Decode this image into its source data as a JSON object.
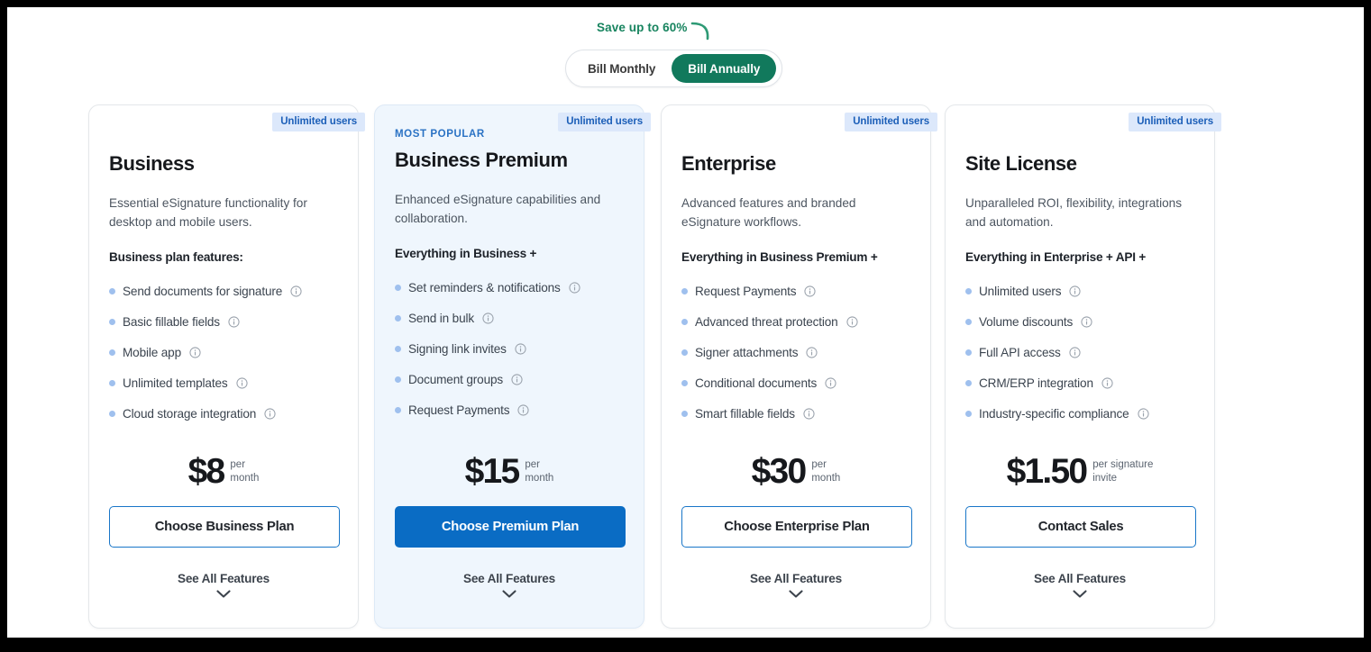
{
  "billing": {
    "save_note": "Save up to 60%",
    "options": [
      {
        "label": "Bill Monthly",
        "active": false
      },
      {
        "label": "Bill Annually",
        "active": true
      }
    ]
  },
  "colors": {
    "accent_blue": "#0a6cc4",
    "outline_blue": "#1976c8",
    "badge_bg": "#dce8fb",
    "badge_text": "#1c5fb8",
    "toggle_green": "#11795c",
    "save_green": "#18845f",
    "highlight_card_bg": "#eff6fd",
    "bullet_blue": "#9fc0ee"
  },
  "plans": [
    {
      "badge": "Unlimited users",
      "tag": "",
      "name": "Business",
      "description": "Essential eSignature functionality for desktop and mobile users.",
      "features_head": "Business plan features:",
      "features": [
        "Send documents for signature",
        "Basic fillable fields",
        "Mobile app",
        "Unlimited templates",
        "Cloud storage integration"
      ],
      "price": "$8",
      "price_unit_line1": "per",
      "price_unit_line2": "month",
      "cta": "Choose Business Plan",
      "cta_style": "outline",
      "see_all": "See All Features",
      "highlight": false
    },
    {
      "badge": "Unlimited users",
      "tag": "MOST POPULAR",
      "name": "Business Premium",
      "description": "Enhanced eSignature capabilities and collaboration.",
      "features_head": "Everything in Business +",
      "features": [
        "Set reminders & notifications",
        "Send in bulk",
        "Signing link invites",
        "Document groups",
        "Request Payments"
      ],
      "price": "$15",
      "price_unit_line1": "per",
      "price_unit_line2": "month",
      "cta": "Choose Premium Plan",
      "cta_style": "solid",
      "see_all": "See All Features",
      "highlight": true
    },
    {
      "badge": "Unlimited users",
      "tag": "",
      "name": "Enterprise",
      "description": "Advanced features and branded eSignature workflows.",
      "features_head": "Everything in Business Premium +",
      "features": [
        "Request Payments",
        "Advanced threat protection",
        "Signer attachments",
        "Conditional documents",
        "Smart fillable fields"
      ],
      "price": "$30",
      "price_unit_line1": "per",
      "price_unit_line2": "month",
      "cta": "Choose Enterprise Plan",
      "cta_style": "outline",
      "see_all": "See All Features",
      "highlight": false
    },
    {
      "badge": "Unlimited users",
      "tag": "",
      "name": "Site License",
      "description": "Unparalleled ROI, flexibility, integrations and automation.",
      "features_head": "Everything in Enterprise + API +",
      "features": [
        "Unlimited users",
        "Volume discounts",
        "Full API access",
        "CRM/ERP integration",
        "Industry-specific compliance"
      ],
      "price": "$1.50",
      "price_unit_line1": "per signature",
      "price_unit_line2": "invite",
      "cta": "Contact Sales",
      "cta_style": "outline",
      "see_all": "See All Features",
      "highlight": false
    }
  ]
}
